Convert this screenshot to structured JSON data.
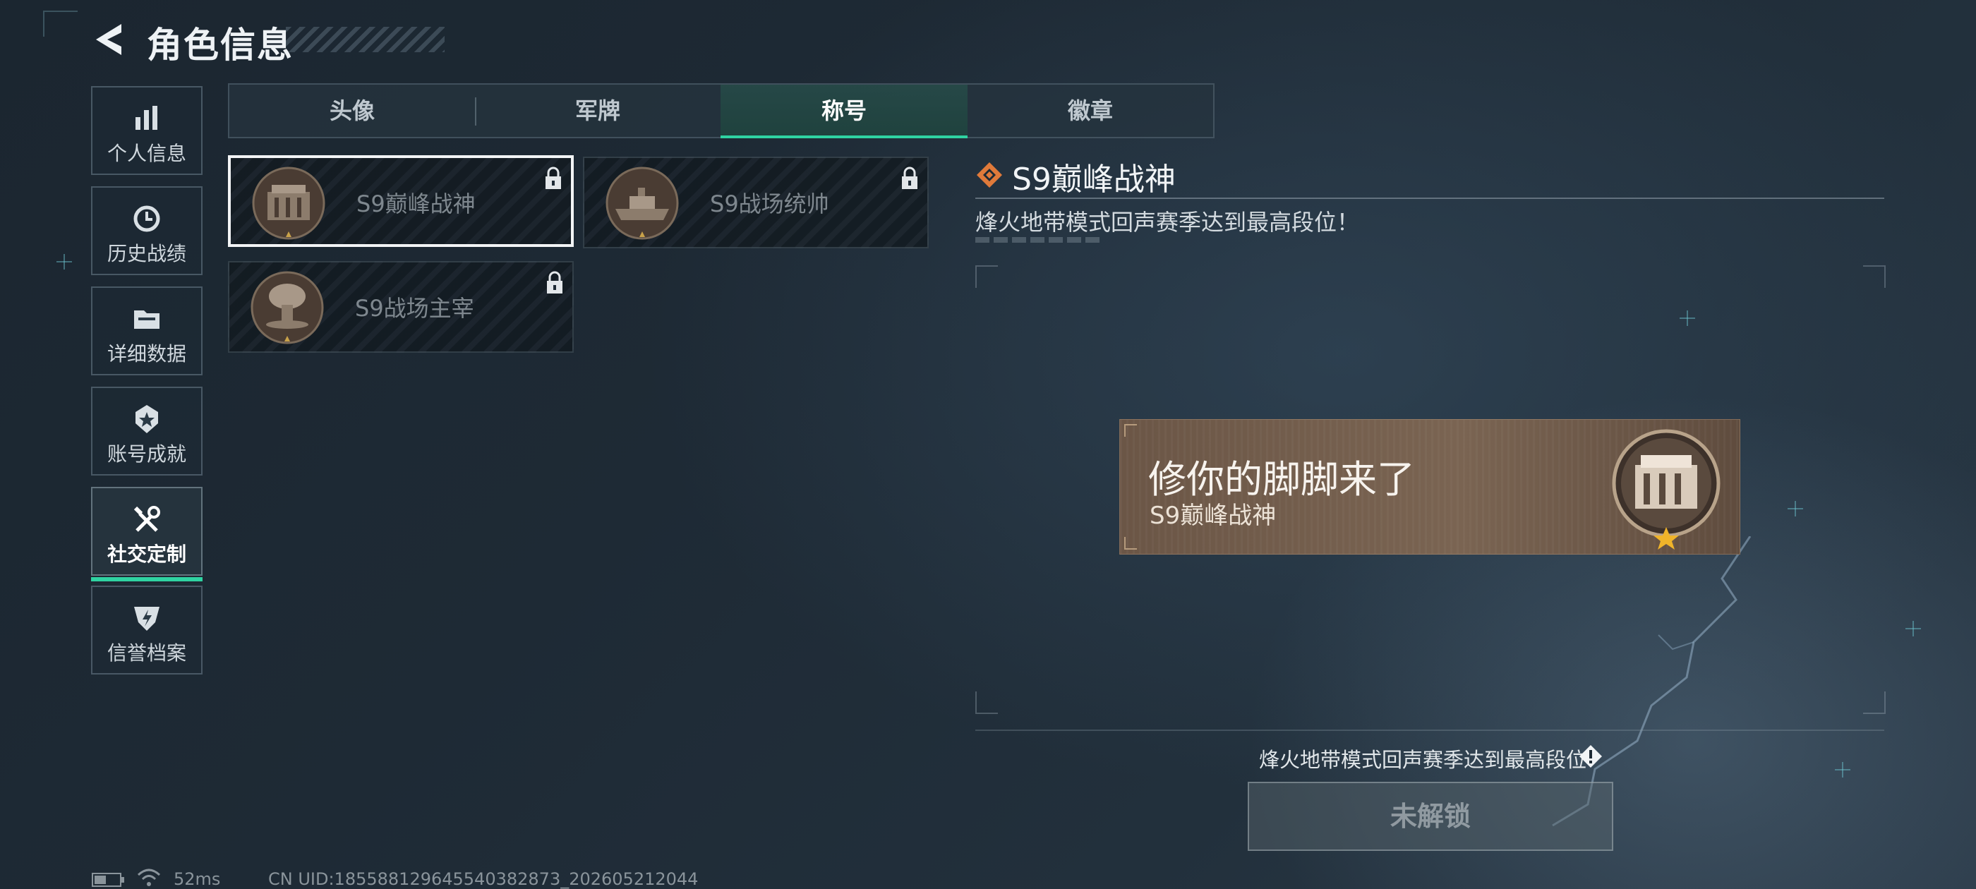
{
  "header": {
    "title": "角色信息"
  },
  "sidebar": {
    "items": [
      {
        "label": "个人信息",
        "icon": "bar-chart-icon"
      },
      {
        "label": "历史战绩",
        "icon": "history-clock-icon"
      },
      {
        "label": "详细数据",
        "icon": "folder-icon"
      },
      {
        "label": "账号成就",
        "icon": "achievement-medal-icon"
      },
      {
        "label": "社交定制",
        "icon": "wrench-tools-icon",
        "active": true
      },
      {
        "label": "信誉档案",
        "icon": "credit-shield-icon"
      }
    ]
  },
  "tabs": [
    {
      "label": "头像"
    },
    {
      "label": "军牌"
    },
    {
      "label": "称号",
      "active": true
    },
    {
      "label": "徽章"
    }
  ],
  "titles": [
    {
      "name": "S9巅峰战神",
      "locked": true,
      "selected": true,
      "medal": "fortress-medal-icon"
    },
    {
      "name": "S9战场统帅",
      "locked": true,
      "selected": false,
      "medal": "battleship-medal-icon"
    },
    {
      "name": "S9战场主宰",
      "locked": true,
      "selected": false,
      "medal": "mushroom-cloud-medal-icon"
    }
  ],
  "detail": {
    "title": "S9巅峰战神",
    "description": "烽火地带模式回声赛季达到最高段位！",
    "accent_color": "#e07a3a"
  },
  "nameplate": {
    "nickname": "修你的脚脚来了",
    "title": "S9巅峰战神"
  },
  "unlock": {
    "requirement": "烽火地带模式回声赛季达到最高段位",
    "button_label": "未解锁"
  },
  "status": {
    "ping": "52ms",
    "uid": "CN UID:18558812964554038​2873_202605212044"
  },
  "colors": {
    "active_accent": "#2fd3a2",
    "background": "#1e2a35"
  }
}
